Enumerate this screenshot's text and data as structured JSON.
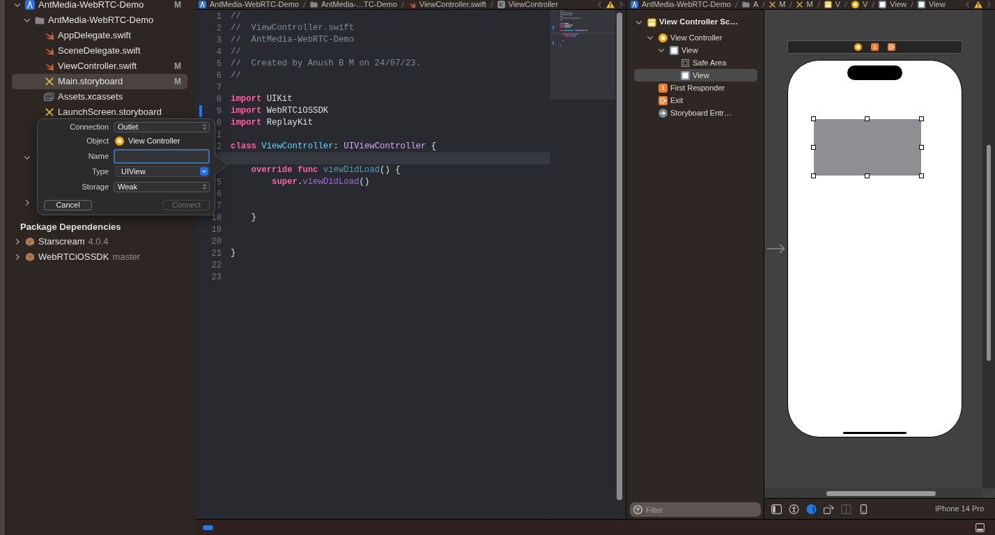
{
  "navigator": {
    "tree": [
      {
        "kind": "project",
        "name": "AntMedia-WebRTC-Demo",
        "status": "M",
        "expanded": true,
        "selected": false,
        "children": [
          {
            "kind": "folder",
            "name": "AntMedia-WebRTC-Demo",
            "expanded": true,
            "selected": false,
            "children": [
              {
                "kind": "swift",
                "name": "AppDelegate.swift",
                "selected": false
              },
              {
                "kind": "swift",
                "name": "SceneDelegate.swift",
                "selected": false
              },
              {
                "kind": "swift",
                "name": "ViewController.swift",
                "status": "M",
                "selected": false
              },
              {
                "kind": "storyboard",
                "name": "Main.storyboard",
                "status": "M",
                "selected": true
              },
              {
                "kind": "assets",
                "name": "Assets.xcassets",
                "selected": false
              },
              {
                "kind": "storyboard",
                "name": "LaunchScreen.storyboard",
                "selected": false
              }
            ]
          },
          {
            "expanded": true,
            "selected": false
          },
          {
            "expanded": false,
            "selected": false
          }
        ]
      }
    ],
    "packages_title": "Package Dependencies",
    "packages": [
      {
        "name": "Starscream",
        "version": "4.0.4",
        "expanded": false,
        "selected": false
      },
      {
        "name": "WebRTCiOSSDK",
        "version": "master",
        "expanded": false,
        "selected": false
      }
    ]
  },
  "editor": {
    "breadcrumb": [
      {
        "kind": "project",
        "text": "AntMedia-WebRTC-Demo"
      },
      {
        "kind": "folder",
        "text": "AntMedia-…TC-Demo"
      },
      {
        "kind": "swift",
        "text": "ViewController.swift"
      },
      {
        "kind": "class",
        "icon_text": "C",
        "text": "ViewController"
      }
    ],
    "lines": [
      {
        "number": "1",
        "current": false,
        "changed": false,
        "tokens": [
          {
            "kind": "comment",
            "text": "//"
          }
        ]
      },
      {
        "number": "2",
        "current": false,
        "changed": false,
        "tokens": [
          {
            "kind": "comment",
            "text": "//  ViewController.swift"
          }
        ]
      },
      {
        "number": "3",
        "current": false,
        "changed": false,
        "tokens": [
          {
            "kind": "comment",
            "text": "//  AntMedia-WebRTC-Demo"
          }
        ]
      },
      {
        "number": "4",
        "current": false,
        "changed": false,
        "tokens": [
          {
            "kind": "comment",
            "text": "//"
          }
        ]
      },
      {
        "number": "5",
        "current": false,
        "changed": false,
        "tokens": [
          {
            "kind": "comment",
            "text": "//  Created by Anush B M on 24/07/23."
          }
        ]
      },
      {
        "number": "6",
        "current": false,
        "changed": false,
        "tokens": [
          {
            "kind": "comment",
            "text": "//"
          }
        ]
      },
      {
        "number": "7",
        "current": false,
        "changed": false
      },
      {
        "number": "8",
        "current": false,
        "changed": false,
        "tokens": [
          {
            "kind": "keyword",
            "text": "import"
          },
          {
            "kind": "plain",
            "text": " UIKit"
          }
        ]
      },
      {
        "number": "9",
        "current": false,
        "changed": true,
        "tokens": [
          {
            "kind": "keyword",
            "text": "import"
          },
          {
            "kind": "plain",
            "text": " WebRTCiOSSDK"
          }
        ]
      },
      {
        "number": "0",
        "current": false,
        "changed": false,
        "tokens": [
          {
            "kind": "keyword",
            "text": "import"
          },
          {
            "kind": "plain",
            "text": " ReplayKit"
          }
        ]
      },
      {
        "number": "1",
        "current": false,
        "changed": false
      },
      {
        "number": "2",
        "current": false,
        "changed": false,
        "tokens": [
          {
            "kind": "keyword",
            "text": "class "
          },
          {
            "kind": "decl-type",
            "text": "ViewController"
          },
          {
            "kind": "plain",
            "text": ": "
          },
          {
            "kind": "class-name",
            "text": "UIViewController"
          },
          {
            "kind": "plain",
            "text": " {"
          }
        ]
      },
      {
        "current": true,
        "changed": false
      },
      {
        "current": false,
        "changed": false,
        "tokens": [
          {
            "kind": "keyword",
            "text": "    override func "
          },
          {
            "kind": "decl-other",
            "text": "viewDidLoad"
          },
          {
            "kind": "plain",
            "text": "() {"
          }
        ]
      },
      {
        "number": "5",
        "current": false,
        "changed": false,
        "tokens": [
          {
            "kind": "keyword",
            "text": "        super"
          },
          {
            "kind": "plain",
            "text": "."
          },
          {
            "kind": "method",
            "text": "viewDidLoad"
          },
          {
            "kind": "plain",
            "text": "()"
          }
        ]
      },
      {
        "number": "6",
        "current": false,
        "changed": false
      },
      {
        "number": "7",
        "current": false,
        "changed": false
      },
      {
        "number": "18",
        "current": false,
        "changed": false,
        "tokens": [
          {
            "kind": "plain",
            "text": "    }"
          }
        ]
      },
      {
        "number": "19",
        "current": false,
        "changed": false
      },
      {
        "number": "20",
        "current": false,
        "changed": false
      },
      {
        "number": "21",
        "current": false,
        "changed": false,
        "tokens": [
          {
            "kind": "plain",
            "text": "}"
          }
        ]
      },
      {
        "number": "22",
        "current": false,
        "changed": false
      },
      {
        "number": "23",
        "current": false,
        "changed": false
      }
    ]
  },
  "connection_popover": {
    "rows": [
      {
        "kind": "popup",
        "label": "Connection",
        "value": "Outlet",
        "focused": false
      },
      {
        "kind": "object",
        "label": "Object",
        "value": "View Controller",
        "focused": false
      },
      {
        "kind": "field",
        "label": "Name",
        "focused": true
      },
      {
        "kind": "combo",
        "label": "Type",
        "value": "UIView",
        "focused": false
      },
      {
        "kind": "popup",
        "label": "Storage",
        "value": "Weak",
        "focused": false
      }
    ],
    "buttons": [
      {
        "label": "Cancel",
        "disabled": false
      },
      {
        "label": "Connect",
        "disabled": true
      }
    ]
  },
  "interface_builder": {
    "breadcrumb": [
      {
        "kind": "project",
        "text": "AntMedia-WebRTC-Demo"
      },
      {
        "kind": "folder",
        "text": "A"
      },
      {
        "kind": "storyboard",
        "text": "M"
      },
      {
        "kind": "storyboard",
        "text": "M"
      },
      {
        "kind": "scene",
        "text": "V"
      },
      {
        "kind": "controller",
        "text": "V"
      },
      {
        "kind": "view",
        "text": "View"
      },
      {
        "kind": "view",
        "text": "View"
      }
    ],
    "outline": [
      {
        "kind": "scene",
        "name": "View Controller Sc…",
        "expanded": true,
        "selected": false,
        "children": [
          {
            "kind": "controller",
            "name": "View Controller",
            "expanded": true,
            "selected": false,
            "children": [
              {
                "kind": "view",
                "name": "View",
                "expanded": true,
                "selected": false,
                "children": [
                  {
                    "kind": "safe-area",
                    "name": "Safe Area",
                    "selected": false
                  },
                  {
                    "kind": "view",
                    "name": "View",
                    "selected": true
                  }
                ]
              }
            ]
          },
          {
            "kind": "responder",
            "icon_text": "1",
            "name": "First Responder",
            "selected": false
          },
          {
            "kind": "exit",
            "name": "Exit",
            "selected": false
          },
          {
            "kind": "entry",
            "name": "Storyboard Entr…",
            "selected": false
          }
        ]
      }
    ],
    "filter": {
      "placeholder": "Filter"
    },
    "scene_dock": [
      {
        "kind": "controller"
      },
      {
        "kind": "responder",
        "icon_text": "1"
      },
      {
        "kind": "exit"
      }
    ],
    "subview": {
      "selected": true
    },
    "toolbar": [
      {
        "kind": "sidebar",
        "disabled": false
      },
      {
        "kind": "accessibility",
        "disabled": false
      },
      {
        "kind": "appearance",
        "disabled": false
      },
      {
        "kind": "orientation",
        "disabled": false
      },
      {
        "kind": "split",
        "disabled": true
      },
      {
        "kind": "device",
        "disabled": false
      }
    ],
    "device": "iPhone 14 Pro"
  }
}
